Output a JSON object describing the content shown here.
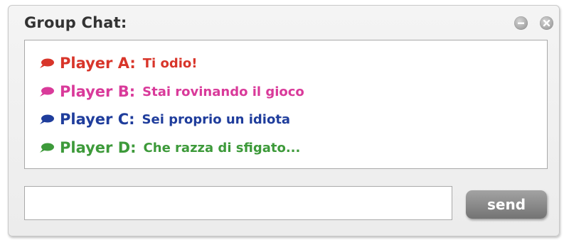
{
  "window": {
    "title": "Group Chat:",
    "controls": {
      "minimize_icon": "minus-circle-icon",
      "close_icon": "close-circle-icon"
    }
  },
  "messages": [
    {
      "player": "Player A:",
      "text": "Ti odio!",
      "color": "#d8352a",
      "icon": "speech-bubble-icon"
    },
    {
      "player": "Player B:",
      "text": "Stai rovinando il gioco",
      "color": "#d93a9a",
      "icon": "speech-bubble-icon"
    },
    {
      "player": "Player C:",
      "text": "Sei proprio un idiota",
      "color": "#1f3d9c",
      "icon": "speech-bubble-icon"
    },
    {
      "player": "Player D:",
      "text": "Che razza di sfigato...",
      "color": "#3d9a3a",
      "icon": "speech-bubble-icon"
    }
  ],
  "composer": {
    "value": "",
    "send_label": "send"
  }
}
